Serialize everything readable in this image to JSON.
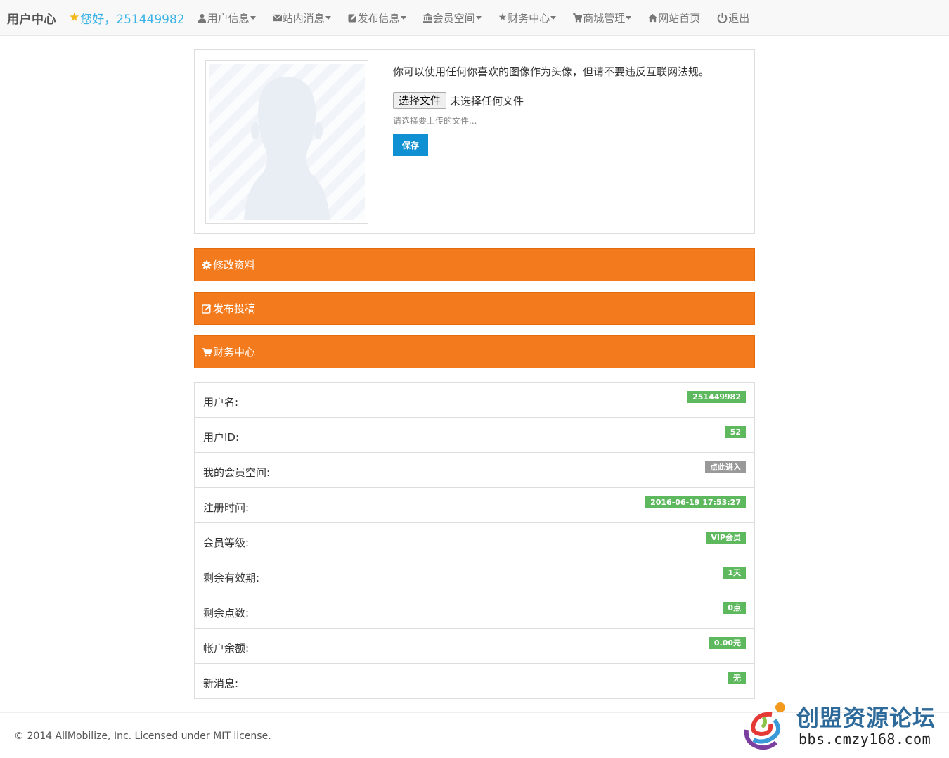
{
  "navbar": {
    "brand": "用户中心",
    "greeting": "您好，251449982",
    "items": [
      {
        "label": "用户信息",
        "icon": "user-icon",
        "dropdown": true
      },
      {
        "label": "站内消息",
        "icon": "envelope-icon",
        "dropdown": true
      },
      {
        "label": "发布信息",
        "icon": "edit-icon",
        "dropdown": true
      },
      {
        "label": "会员空间",
        "icon": "bank-icon",
        "dropdown": true
      },
      {
        "label": "财务中心",
        "icon": "star-icon",
        "dropdown": true
      },
      {
        "label": "商城管理",
        "icon": "cart-icon",
        "dropdown": true
      },
      {
        "label": "网站首页",
        "icon": "home-icon",
        "dropdown": false
      },
      {
        "label": "退出",
        "icon": "power-icon",
        "dropdown": false
      }
    ]
  },
  "avatar": {
    "instruction": "你可以使用任何你喜欢的图像作为头像，但请不要违反互联网法规。",
    "choose_file": "选择文件",
    "file_status": "未选择任何文件",
    "help": "请选择要上传的文件...",
    "save": "保存"
  },
  "panels": {
    "edit_profile": "修改资料",
    "publish": "发布投稿",
    "finance": "财务中心"
  },
  "info": [
    {
      "label": "用户名:",
      "value": "251449982",
      "style": "success"
    },
    {
      "label": "用户ID:",
      "value": "52",
      "style": "success"
    },
    {
      "label": "我的会员空间:",
      "value": "点此进入",
      "style": "gray"
    },
    {
      "label": "注册时间:",
      "value": "2016-06-19 17:53:27",
      "style": "success"
    },
    {
      "label": "会员等级:",
      "value": "VIP会员",
      "style": "success"
    },
    {
      "label": "剩余有效期:",
      "value": "1天",
      "style": "success"
    },
    {
      "label": "剩余点数:",
      "value": "0点",
      "style": "success"
    },
    {
      "label": "帐户余额:",
      "value": "0.00元",
      "style": "success"
    },
    {
      "label": "新消息:",
      "value": "无",
      "style": "success"
    }
  ],
  "footer": {
    "copyright": "© 2014 AllMobilize, Inc. Licensed under MIT license."
  },
  "watermark": {
    "title": "创盟资源论坛",
    "url": "bbs.cmzy168.com"
  },
  "colors": {
    "accent_orange": "#f37b1d",
    "badge_green": "#5eb95e",
    "badge_gray": "#999999",
    "save_blue": "#0e90d2",
    "greeting_blue": "#3bb3e6"
  }
}
